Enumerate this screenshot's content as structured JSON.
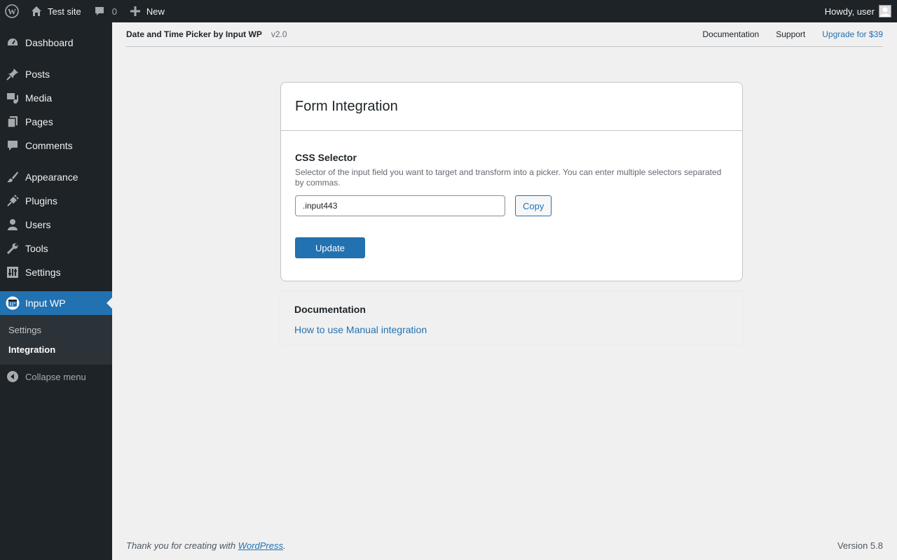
{
  "adminbar": {
    "site_name": "Test site",
    "comments_count": "0",
    "new_label": "New",
    "howdy": "Howdy, user"
  },
  "sidebar": {
    "items": [
      {
        "label": "Dashboard",
        "icon": "dashboard-icon"
      },
      {
        "label": "Posts",
        "icon": "pin-icon"
      },
      {
        "label": "Media",
        "icon": "media-icon"
      },
      {
        "label": "Pages",
        "icon": "pages-icon"
      },
      {
        "label": "Comments",
        "icon": "comment-icon"
      },
      {
        "label": "Appearance",
        "icon": "brush-icon"
      },
      {
        "label": "Plugins",
        "icon": "plug-icon"
      },
      {
        "label": "Users",
        "icon": "user-icon"
      },
      {
        "label": "Tools",
        "icon": "wrench-icon"
      },
      {
        "label": "Settings",
        "icon": "settings-icon"
      },
      {
        "label": "Input WP",
        "icon": "input-wp-icon"
      }
    ],
    "submenu": [
      {
        "label": "Settings"
      },
      {
        "label": "Integration"
      }
    ],
    "collapse_label": "Collapse menu"
  },
  "plugin_header": {
    "title": "Date and Time Picker by Input WP",
    "version": "v2.0",
    "links": {
      "documentation": "Documentation",
      "support": "Support",
      "upgrade": "Upgrade for $39"
    }
  },
  "card": {
    "title": "Form Integration",
    "field_label": "CSS Selector",
    "field_description": "Selector of the input field you want to target and transform into a picker. You can enter multiple selectors separated by commas.",
    "input_value": ".input443",
    "copy_label": "Copy",
    "update_label": "Update"
  },
  "documentation": {
    "title": "Documentation",
    "link": "How to use Manual integration"
  },
  "footer": {
    "thanks_prefix": "Thank you for creating with ",
    "wp_link": "WordPress",
    "thanks_suffix": ".",
    "version": "Version 5.8"
  },
  "colors": {
    "admin_dark": "#1d2327",
    "accent": "#2271b1",
    "background": "#f0f0f1"
  }
}
